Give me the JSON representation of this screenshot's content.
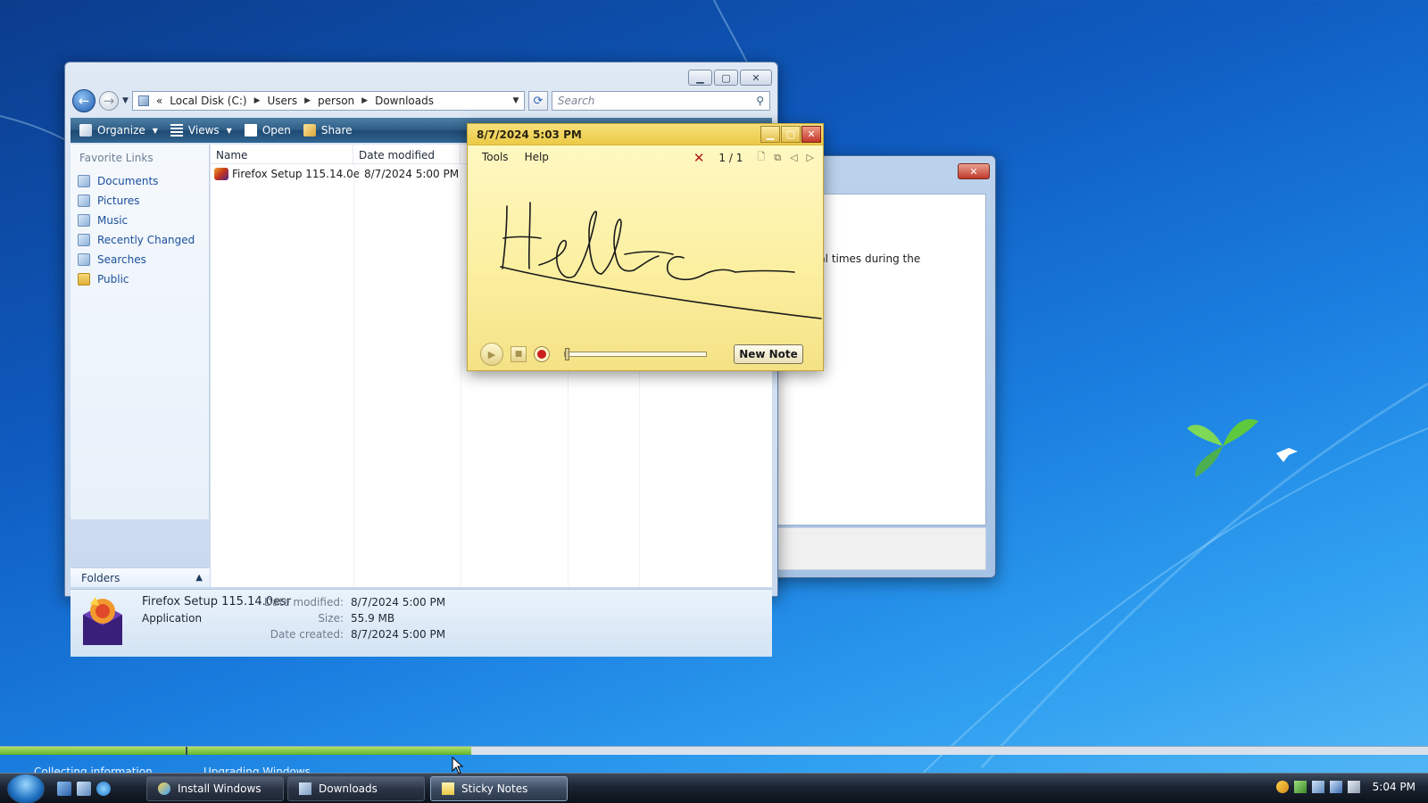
{
  "explorer": {
    "breadcrumb": [
      "Local Disk (C:)",
      "Users",
      "person",
      "Downloads"
    ],
    "breadcrumb_lead": "«",
    "search_placeholder": "Search",
    "toolbar": {
      "organize": "Organize",
      "views": "Views",
      "open": "Open",
      "share": "Share"
    },
    "favorite_links_title": "Favorite Links",
    "favorite_links": [
      "Documents",
      "Pictures",
      "Music",
      "Recently Changed",
      "Searches",
      "Public"
    ],
    "folders_label": "Folders",
    "columns": [
      "Name",
      "Date modified"
    ],
    "files": [
      {
        "name": "Firefox Setup 115.14.0esr",
        "date_modified": "8/7/2024 5:00 PM"
      }
    ],
    "details": {
      "name": "Firefox Setup 115.14.0esr",
      "type": "Application",
      "date_modified_label": "Date modified:",
      "date_modified": "8/7/2024 5:00 PM",
      "size_label": "Size:",
      "size": "55.9 MB",
      "date_created_label": "Date created:",
      "date_created": "8/7/2024 5:00 PM"
    }
  },
  "dialog": {
    "text": "eral times during the"
  },
  "sticky": {
    "title": "8/7/2024 5:03 PM",
    "menu": [
      "Tools",
      "Help"
    ],
    "page": "1 / 1",
    "new_note": "New Note",
    "handwriting": "Hello",
    "playback_progress": 0
  },
  "setup": {
    "steps": [
      "Collecting information",
      "Upgrading Windows"
    ],
    "progress": 0.33
  },
  "taskbar": {
    "tasks": [
      "Install Windows",
      "Downloads",
      "Sticky Notes"
    ],
    "active_task": "Sticky Notes",
    "clock": "5:04 PM"
  },
  "colors": {
    "sticky_yellow": "#fbefa0",
    "explorer_cmdbar": "#2e5d86",
    "setup_progress": "#62b22a"
  },
  "icons": [
    "back-arrow-icon",
    "forward-arrow-icon",
    "refresh-icon",
    "search-icon",
    "organize-icon",
    "views-icon",
    "open-icon",
    "share-icon",
    "firefox-icon",
    "windows-orb-icon"
  ]
}
